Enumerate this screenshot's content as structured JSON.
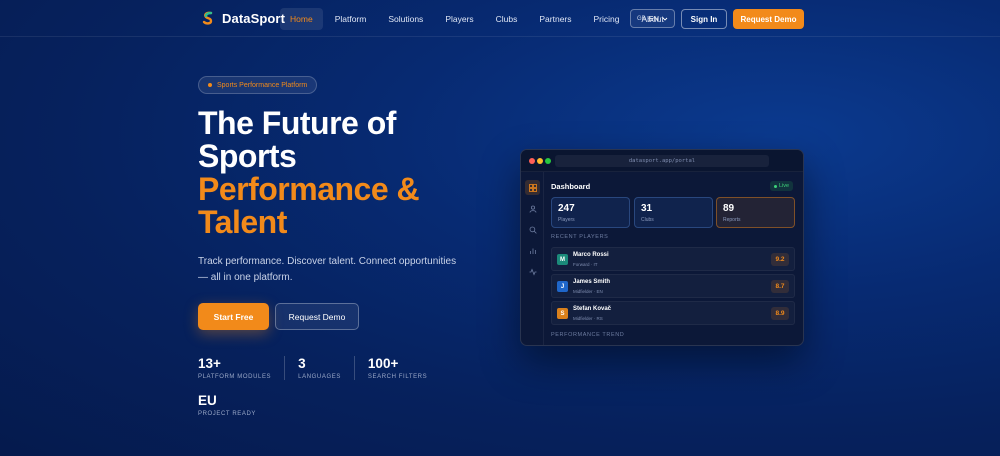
{
  "nav": {
    "brand": "DataSport",
    "links": [
      "Home",
      "Platform",
      "Solutions",
      "Players",
      "Clubs",
      "Partners",
      "Pricing",
      "About"
    ],
    "language": {
      "flag": "GB",
      "code": "EN"
    },
    "sign_in": "Sign In",
    "request_demo": "Request Demo"
  },
  "hero": {
    "badge": "Sports Performance Platform",
    "headline_line1": "The Future of",
    "headline_line2": "Sports",
    "headline_line3": "Performance &",
    "headline_line4": "Talent",
    "subtitle": "Track performance. Discover talent. Connect opportunities — all in one platform.",
    "cta_primary": "Start Free",
    "cta_secondary": "Request Demo",
    "stats": [
      {
        "value": "13+",
        "label": "PLATFORM MODULES"
      },
      {
        "value": "3",
        "label": "LANGUAGES"
      },
      {
        "value": "100+",
        "label": "SEARCH FILTERS"
      }
    ],
    "stat_extra": {
      "value": "EU",
      "label": "PROJECT READY"
    }
  },
  "preview": {
    "url": "datasport.app/portal",
    "title": "Dashboard",
    "live": "Live",
    "kpis": [
      {
        "value": "247",
        "label": "Players"
      },
      {
        "value": "31",
        "label": "Clubs"
      },
      {
        "value": "89",
        "label": "Reports"
      }
    ],
    "recent_label": "RECENT PLAYERS",
    "players": [
      {
        "initial": "M",
        "name": "Marco Rossi",
        "meta": "Forward · IT",
        "score": "9.2",
        "color": "#1b8a7a"
      },
      {
        "initial": "J",
        "name": "James Smith",
        "meta": "Midfielder · EN",
        "score": "8.7",
        "color": "#1f66c9"
      },
      {
        "initial": "S",
        "name": "Stefan Kovač",
        "meta": "Midfielder · RS",
        "score": "8.9",
        "color": "#d9801c"
      }
    ],
    "trend_label": "PERFORMANCE TREND"
  },
  "colors": {
    "accent": "#f28a1a",
    "live": "#3dd17a",
    "background": "#06215d"
  }
}
